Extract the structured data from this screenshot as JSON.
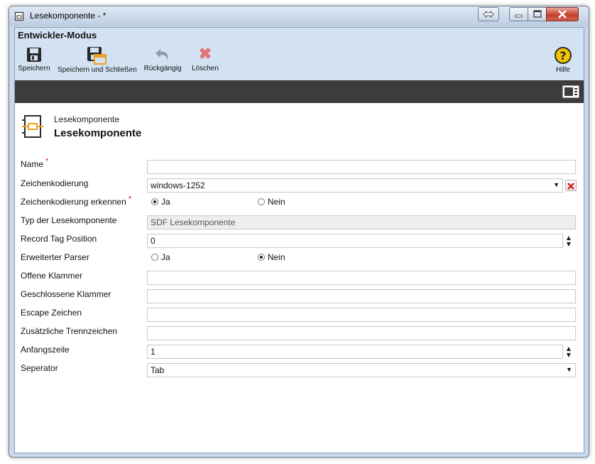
{
  "window": {
    "title": "Lesekomponente - *"
  },
  "ribbon": {
    "title": "Entwickler-Modus",
    "buttons": {
      "save": "Speichern",
      "save_close": "Speichern und Schließen",
      "undo": "Rückgängig",
      "delete": "Löschen",
      "help": "Hilfe"
    }
  },
  "header": {
    "subtitle": "Lesekomponente",
    "title": "Lesekomponente"
  },
  "form": {
    "name": {
      "label": "Name",
      "required": "*",
      "value": ""
    },
    "encoding": {
      "label": "Zeichenkodierung",
      "value": "windows-1252"
    },
    "detect_encoding": {
      "label": "Zeichenkodierung erkennen",
      "required": "*",
      "option_yes": "Ja",
      "option_no": "Nein",
      "selected": "Ja"
    },
    "reader_type": {
      "label": "Typ der Lesekomponente",
      "value": "SDF Lesekomponente"
    },
    "record_tag": {
      "label": "Record Tag Position",
      "value": "0"
    },
    "extended_parser": {
      "label": "Erweiterter Parser",
      "option_yes": "Ja",
      "option_no": "Nein",
      "selected": "Nein"
    },
    "open_bracket": {
      "label": "Offene Klammer",
      "value": ""
    },
    "closed_bracket": {
      "label": "Geschlossene Klammer",
      "value": ""
    },
    "escape_char": {
      "label": "Escape Zeichen",
      "value": ""
    },
    "extra_separators": {
      "label": "Zusätzliche Trennzeichen",
      "value": ""
    },
    "start_line": {
      "label": "Anfangszeile",
      "value": "1"
    },
    "separator": {
      "label": "Seperator",
      "value": "Tab"
    }
  },
  "colors": {
    "save_icon": "#2a2a2a",
    "accent_orange": "#f0a020",
    "delete_red": "#e05050",
    "help_yellow": "#f5c400"
  }
}
